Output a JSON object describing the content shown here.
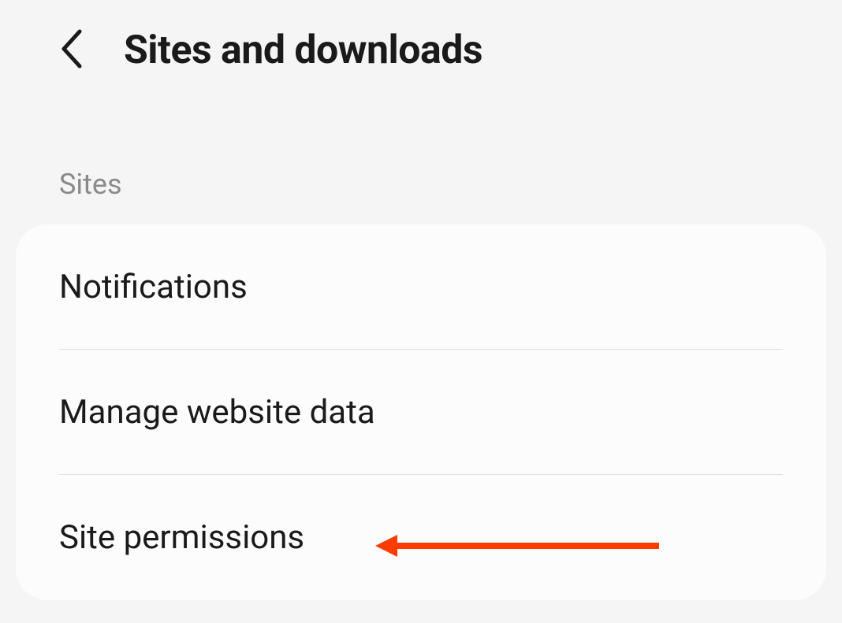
{
  "header": {
    "title": "Sites and downloads"
  },
  "section": {
    "label": "Sites",
    "items": [
      {
        "label": "Notifications"
      },
      {
        "label": "Manage website data"
      },
      {
        "label": "Site permissions"
      }
    ]
  },
  "annotation": {
    "color": "#ff3b00"
  }
}
